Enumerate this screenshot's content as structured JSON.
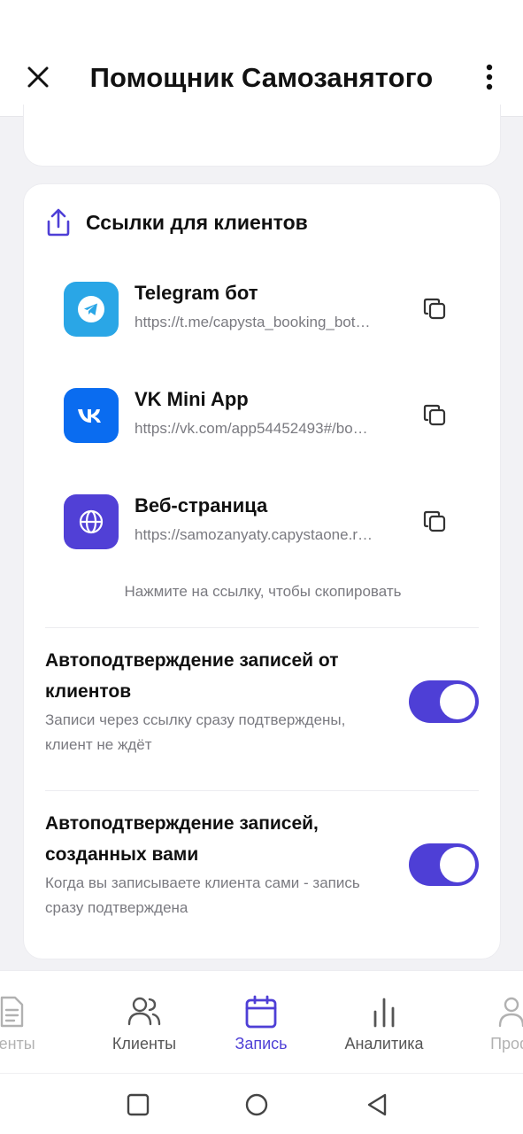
{
  "header": {
    "title": "Помощник Самозанятого",
    "close_icon": "close-icon",
    "menu_icon": "more-vertical-icon"
  },
  "links_section": {
    "title": "Ссылки для клиентов",
    "icon": "share-upload-icon",
    "items": [
      {
        "name": "Telegram бот",
        "url": "https://t.me/capysta_booking_bot…",
        "icon": "telegram-icon",
        "color": "#2aa6e6"
      },
      {
        "name": "VK Mini App",
        "url": "https://vk.com/app54452493#/bo…",
        "icon": "vk-icon",
        "color": "#0a6cf0"
      },
      {
        "name": "Веб-страница",
        "url": "https://samozanyaty.capystaone.r…",
        "icon": "globe-icon",
        "color": "#5140d6"
      }
    ],
    "hint": "Нажмите на ссылку, чтобы скопировать"
  },
  "toggles": [
    {
      "title": "Автоподтверждение записей от клиентов",
      "description": "Записи через ссылку сразу подтверждены, клиент не ждёт",
      "enabled": true
    },
    {
      "title": "Автоподтверждение записей, созданных вами",
      "description": "Когда вы записываете клиента сами - запись сразу подтверждена",
      "enabled": true
    }
  ],
  "bottom_nav": {
    "items": [
      {
        "label": "менты",
        "icon": "document-icon"
      },
      {
        "label": "Клиенты",
        "icon": "users-icon"
      },
      {
        "label": "Запись",
        "icon": "calendar-icon",
        "active": true
      },
      {
        "label": "Аналитика",
        "icon": "bar-chart-icon"
      },
      {
        "label": "Проф",
        "icon": "user-icon"
      }
    ]
  },
  "system_nav": [
    "recents-square-icon",
    "home-circle-icon",
    "back-triangle-icon"
  ],
  "colors": {
    "accent": "#4e3fd6",
    "text_muted": "#7a7a80",
    "background": "#f2f2f5"
  }
}
